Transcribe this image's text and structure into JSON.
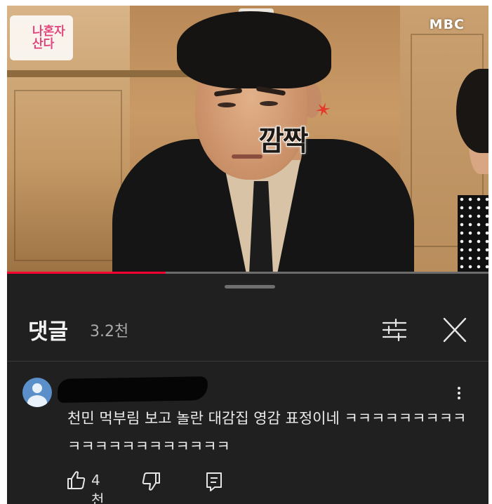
{
  "video": {
    "show_logo": "나혼자산다",
    "channel_brand": "MBC",
    "caption": "깜짝",
    "progress": 0.33
  },
  "comments": {
    "title": "댓글",
    "count": "3.2천",
    "sort_icon": "sort-icon",
    "close_icon": "close-icon",
    "items": [
      {
        "author_redacted": true,
        "text": "천민 먹부림 보고 놀란 대감집 영감 표정이네 ㅋㅋㅋㅋㅋㅋㅋㅋㅋㅋㅋㅋㅋㅋㅋㅋㅋㅋㅋㅋㅋ",
        "likes": "4천",
        "icons": [
          "like-icon",
          "dislike-icon",
          "reply-icon"
        ]
      }
    ]
  },
  "colors": {
    "panel_bg": "#202020",
    "progress_played": "#ff0033",
    "avatar": "#5b8fc9"
  }
}
